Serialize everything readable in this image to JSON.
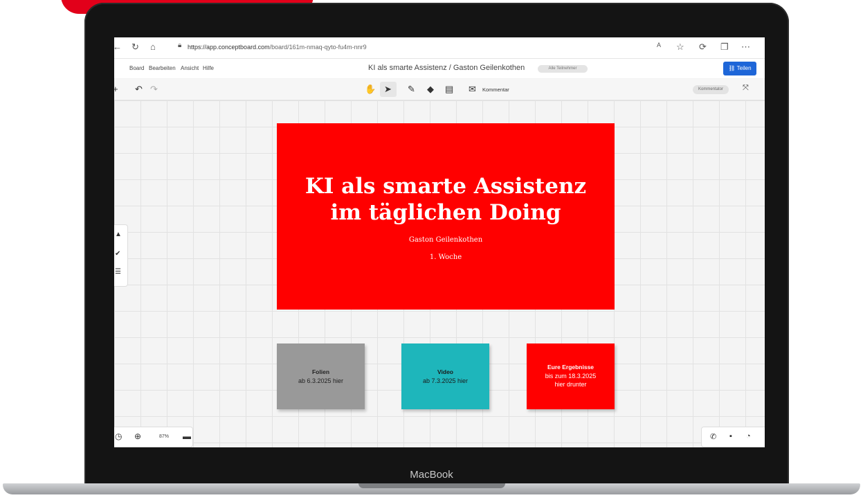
{
  "device": {
    "label": "MacBook"
  },
  "browser": {
    "url_host": "https://app.conceptboard.com",
    "url_path": "/board/161m-nmaq-qyto-fu4m-nnr9"
  },
  "menu": {
    "items": [
      "Board",
      "Bearbeiten",
      "Ansicht",
      "Hilfe"
    ],
    "board_title": "KI als smarte Assistenz / Gaston Geilenkothen",
    "participants": "Alle Teilnehmer",
    "share_label": "Teilen"
  },
  "toolbar": {
    "comment_label": "Kommentar",
    "commentator_label": "Kommentator"
  },
  "slide": {
    "title_line1": "KI als smarte Assistenz",
    "title_line2": "im täglichen Doing",
    "subtitle": "Gaston Geilenkothen",
    "week": "1. Woche"
  },
  "cards": [
    {
      "title": "Folien",
      "line1": "ab 6.3.2025 hier",
      "line2": "",
      "color": "#999999"
    },
    {
      "title": "Video",
      "line1": "ab 7.3.2025 hier",
      "line2": "",
      "color": "#1eb6bb"
    },
    {
      "title": "Eure Ergebnisse",
      "line1": "bis zum  18.3.2025",
      "line2": "hier drunter",
      "color": "#ff0000"
    }
  ],
  "zoom": {
    "value": "87%"
  },
  "colors": {
    "accent_red": "#ff0000",
    "share_blue": "#1e66d8",
    "brand_red": "#e2001a"
  }
}
